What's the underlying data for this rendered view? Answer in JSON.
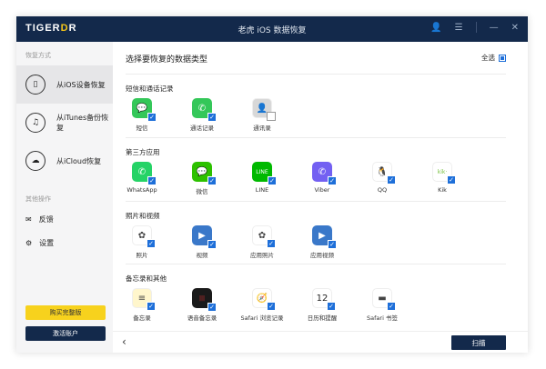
{
  "app": {
    "logo": "TIGERDR",
    "title": "老虎 iOS 数据恢复"
  },
  "sidebar": {
    "section1": "恢复方式",
    "nav": [
      {
        "label": "从iOS设备恢复",
        "icon": "phone-icon"
      },
      {
        "label": "从iTunes备份恢复",
        "icon": "music-icon"
      },
      {
        "label": "从iCloud恢复",
        "icon": "cloud-icon"
      }
    ],
    "section2": "其他操作",
    "ops": [
      {
        "label": "反馈",
        "icon": "feedback-icon"
      },
      {
        "label": "设置",
        "icon": "gear-icon"
      }
    ],
    "buy": "购买完整版",
    "activate": "激活账户"
  },
  "main": {
    "title": "选择要恢复的数据类型",
    "select_all": "全选",
    "scan": "扫描",
    "categories": [
      {
        "label": "短信和通话记录",
        "items": [
          {
            "label": "短信",
            "icon": "messages-icon",
            "color": "#34c759",
            "glyph": "💬",
            "checked": true
          },
          {
            "label": "通话记录",
            "icon": "phone-call-icon",
            "color": "#34c759",
            "glyph": "✆",
            "checked": true
          },
          {
            "label": "通讯录",
            "icon": "contacts-icon",
            "color": "#d8d8d8",
            "glyph": "👤",
            "checked": false
          }
        ]
      },
      {
        "label": "第三方应用",
        "items": [
          {
            "label": "WhatsApp",
            "icon": "whatsapp-icon",
            "color": "#25d366",
            "glyph": "✆",
            "checked": true
          },
          {
            "label": "微信",
            "icon": "wechat-icon",
            "color": "#2dc100",
            "glyph": "💬",
            "checked": true
          },
          {
            "label": "LINE",
            "icon": "line-icon",
            "color": "#00b900",
            "glyph": "LINE",
            "checked": true
          },
          {
            "label": "Viber",
            "icon": "viber-icon",
            "color": "#7360f2",
            "glyph": "✆",
            "checked": true
          },
          {
            "label": "QQ",
            "icon": "qq-icon",
            "color": "#ffffff",
            "glyph": "🐧",
            "checked": true
          },
          {
            "label": "Kik",
            "icon": "kik-icon",
            "color": "#ffffff",
            "glyph": "kik·",
            "checked": true
          }
        ]
      },
      {
        "label": "照片和视频",
        "items": [
          {
            "label": "照片",
            "icon": "photos-icon",
            "color": "#ffffff",
            "glyph": "✿",
            "checked": true
          },
          {
            "label": "视频",
            "icon": "video-icon",
            "color": "#3a78c9",
            "glyph": "▶",
            "checked": true
          },
          {
            "label": "应用照片",
            "icon": "app-photos-icon",
            "color": "#ffffff",
            "glyph": "✿",
            "checked": true
          },
          {
            "label": "应用视频",
            "icon": "app-video-icon",
            "color": "#3a78c9",
            "glyph": "▶",
            "checked": true
          }
        ]
      },
      {
        "label": "备忘录和其他",
        "items": [
          {
            "label": "备忘录",
            "icon": "notes-icon",
            "color": "#fff6cc",
            "glyph": "≡",
            "checked": true
          },
          {
            "label": "语音备忘录",
            "icon": "voice-memo-icon",
            "color": "#1a1a1a",
            "glyph": "|||",
            "checked": true
          },
          {
            "label": "Safari 浏览记录",
            "icon": "safari-icon",
            "color": "#ffffff",
            "glyph": "🧭",
            "checked": true
          },
          {
            "label": "日历和提醒",
            "icon": "calendar-icon",
            "color": "#ffffff",
            "glyph": "12",
            "checked": true
          },
          {
            "label": "Safari 书签",
            "icon": "bookmark-icon",
            "color": "#ffffff",
            "glyph": "▬",
            "checked": true
          }
        ]
      }
    ]
  }
}
